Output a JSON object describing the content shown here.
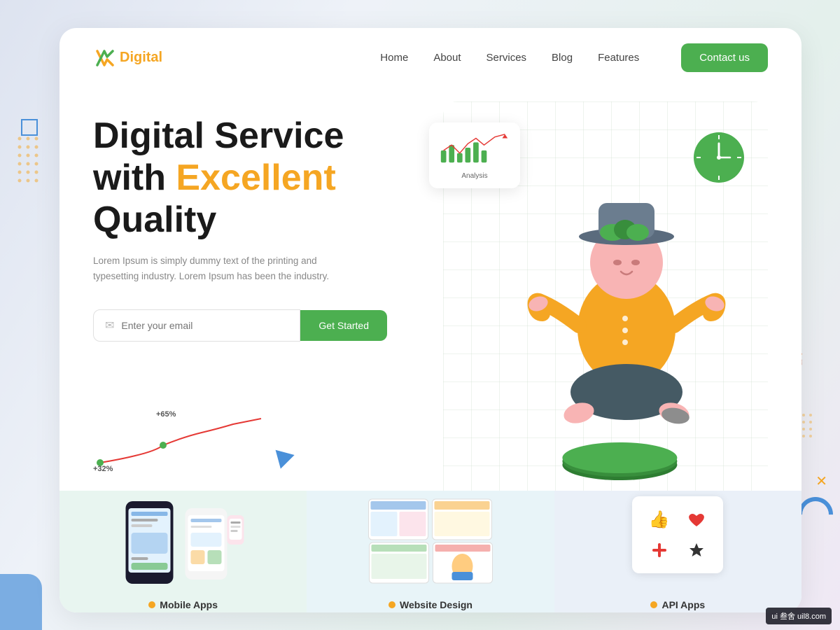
{
  "meta": {
    "title": "Digital Service",
    "watermark": "ui 叁舍 uil8.com"
  },
  "navbar": {
    "logo_text": "Digital",
    "logo_highlight": "Digital",
    "nav_links": [
      {
        "label": "Home",
        "href": "#"
      },
      {
        "label": "About",
        "href": "#"
      },
      {
        "label": "Services",
        "href": "#"
      },
      {
        "label": "Blog",
        "href": "#"
      },
      {
        "label": "Features",
        "href": "#"
      }
    ],
    "contact_btn": "Contact us"
  },
  "hero": {
    "title_line1": "Digital Service",
    "title_line2_plain": "with ",
    "title_line2_highlight": "Excellent",
    "title_line3": "Quality",
    "subtitle": "Lorem Ipsum is simply dummy text of the printing and typesetting industry. Lorem Ipsum has been the industry.",
    "email_placeholder": "Enter your email",
    "get_started_btn": "Get Started",
    "chart_label_65": "+65%",
    "chart_label_32": "+32%",
    "analysis_label": "Analysis"
  },
  "services": [
    {
      "label": "Mobile Apps",
      "dot_color": "#f5a623"
    },
    {
      "label": "Website Design",
      "dot_color": "#f5a623"
    },
    {
      "label": "API Apps",
      "dot_color": "#f5a623"
    }
  ],
  "colors": {
    "accent_green": "#4caf50",
    "accent_orange": "#f5a623",
    "accent_blue": "#4a90d9",
    "text_dark": "#1a1a1a",
    "text_muted": "#888888"
  }
}
